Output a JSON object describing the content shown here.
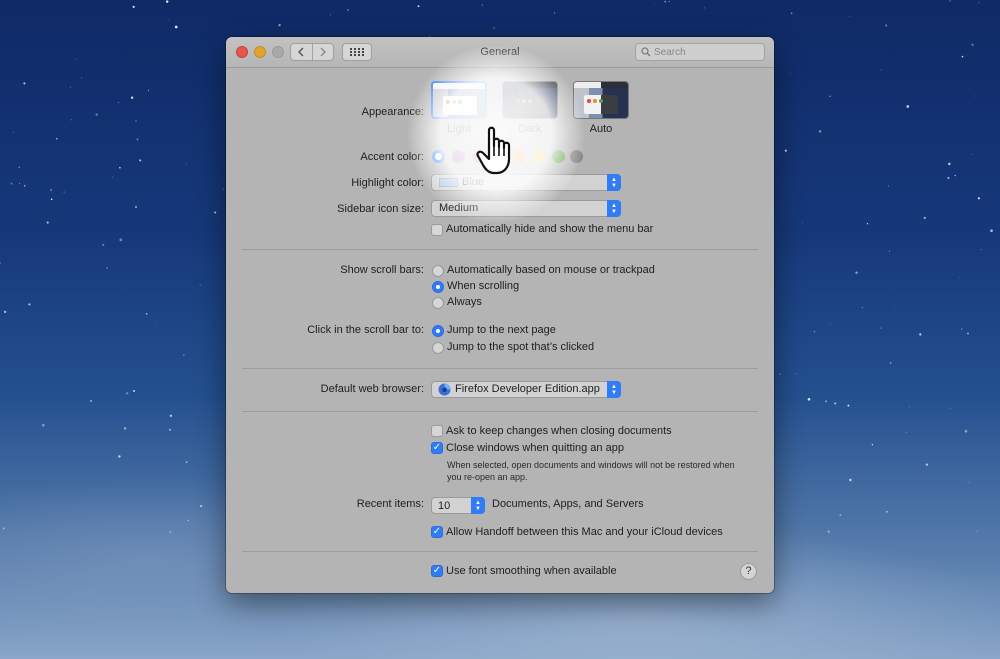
{
  "window": {
    "title": "General"
  },
  "search": {
    "placeholder": "Search"
  },
  "appearance": {
    "label": "Appearance:",
    "options": [
      {
        "label": "Light",
        "selected": true
      },
      {
        "label": "Dark",
        "selected": false
      },
      {
        "label": "Auto",
        "selected": false
      }
    ]
  },
  "accent": {
    "label": "Accent color:",
    "colors": [
      "#2f7cf6",
      "#9b3ea8",
      "#e0428c",
      "#e5453b",
      "#ef8a26",
      "#f3b62c",
      "#5aa342",
      "#8a8a8a"
    ],
    "selected_index": 0
  },
  "highlight": {
    "label": "Highlight color:",
    "value": "Blue",
    "swatch": "#a9c4e8"
  },
  "sidebar_icon": {
    "label": "Sidebar icon size:",
    "value": "Medium"
  },
  "menubar": {
    "label": "Automatically hide and show the menu bar",
    "checked": false
  },
  "scroll_bars": {
    "label": "Show scroll bars:",
    "options": [
      {
        "label": "Automatically based on mouse or trackpad",
        "selected": false
      },
      {
        "label": "When scrolling",
        "selected": true
      },
      {
        "label": "Always",
        "selected": false
      }
    ]
  },
  "scroll_click": {
    "label": "Click in the scroll bar to:",
    "options": [
      {
        "label": "Jump to the next page",
        "selected": true
      },
      {
        "label": "Jump to the spot that’s clicked",
        "selected": false
      }
    ]
  },
  "browser": {
    "label": "Default web browser:",
    "value": "Firefox Developer Edition.app"
  },
  "documents": {
    "ask_keep": {
      "label": "Ask to keep changes when closing documents",
      "checked": false
    },
    "close_windows": {
      "label": "Close windows when quitting an app",
      "checked": true
    },
    "note": "When selected, open documents and windows will not be restored when you re-open an app."
  },
  "recent": {
    "label": "Recent items:",
    "value": "10",
    "suffix": "Documents, Apps, and Servers"
  },
  "handoff": {
    "label": "Allow Handoff between this Mac and your iCloud devices",
    "checked": true
  },
  "font_smoothing": {
    "label": "Use font smoothing when available",
    "checked": true
  },
  "help": {
    "label": "?"
  }
}
